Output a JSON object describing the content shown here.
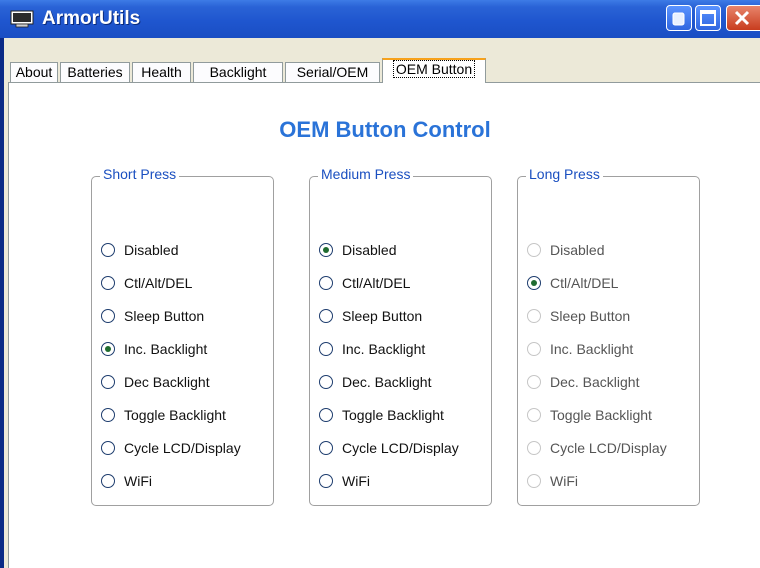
{
  "window": {
    "title": "ArmorUtils"
  },
  "tabs": [
    {
      "label": "About"
    },
    {
      "label": "Batteries"
    },
    {
      "label": "Health"
    },
    {
      "label": "Backlight"
    },
    {
      "label": "Serial/OEM"
    },
    {
      "label": "OEM Button",
      "active": true
    }
  ],
  "heading": "OEM Button Control",
  "groups": [
    {
      "title": "Short Press",
      "selected": "Inc. Backlight",
      "options": [
        "Disabled",
        "Ctl/Alt/DEL",
        "Sleep Button",
        "Inc. Backlight",
        "Dec Backlight",
        "Toggle Backlight",
        "Cycle LCD/Display",
        "WiFi"
      ]
    },
    {
      "title": "Medium Press",
      "selected": "Disabled",
      "options": [
        "Disabled",
        "Ctl/Alt/DEL",
        "Sleep Button",
        "Inc. Backlight",
        "Dec. Backlight",
        "Toggle Backlight",
        "Cycle LCD/Display",
        "WiFi"
      ]
    },
    {
      "title": "Long Press",
      "selected": "Ctl/Alt/DEL",
      "disabled": true,
      "options": [
        "Disabled",
        "Ctl/Alt/DEL",
        "Sleep Button",
        "Inc. Backlight",
        "Dec. Backlight",
        "Toggle Backlight",
        "Cycle LCD/Display",
        "WiFi"
      ]
    }
  ]
}
